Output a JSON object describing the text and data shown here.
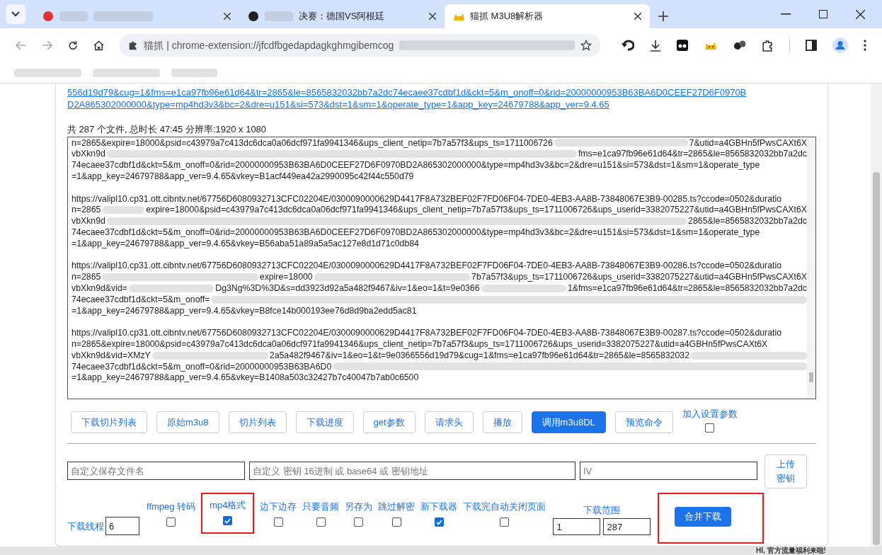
{
  "browser": {
    "tabs": [
      {
        "selected": false
      },
      {
        "title": "决赛：德国VS阿根廷",
        "selected": false
      },
      {
        "title": "猫抓 M3U8解析器",
        "selected": true
      }
    ],
    "address": "猫抓 | chrome-extension://jfcdfbgedapdagkghmgibemcog"
  },
  "link_lines": [
    "556d19d79&cug=1&fms=e1ca97fb96e61d64&tr=2865&le=8565832032bb7a2dc74ecaee37cdbf1d&ckt=5&m_onoff=0&rid=20000000953B63BA6D0CEEF27D6F0970B",
    "D2A865302000000&type=mp4hd3v3&bc=2&dre=u151&si=573&dst=1&sm=1&operate_type=1&app_key=24679788&app_ver=9.4.65"
  ],
  "summary": "共 287 个文件, 总时长 47:45 分辨率:1920 x 1080",
  "playlist_entries": [
    {
      "lines": [
        {
          "parts": [
            "n=2865&expire=18000&psid=c43979a7c413dc6dca0a06dcf971fa9941346&ups_client_netip=7b7a57f3&ups_ts=1711006726",
            "7&utid=a4GBHn5fPwsCAXt6X"
          ]
        },
        {
          "parts": [
            "vbXkn9d",
            "fms=e1ca97fb96e61d64&tr=2865&le=8565832032bb7a2dc"
          ]
        },
        {
          "parts": [
            "74ecaee37cdbf1d&ckt=5&m_onoff=0&rid=20000000953B63BA6D0CEEF27D6F0970BD2A865302000000&type=mp4hd3v3&bc=2&dre=u151&si=573&dst=1&sm=1&operate_type"
          ]
        },
        {
          "parts": [
            "=1&app_key=24679788&app_ver=9.4.65&vkey=B1acf449ea42a2990095c42f44c550d79"
          ]
        }
      ]
    },
    {
      "lines": [
        {
          "parts": [
            "https://valipl10.cp31.ott.cibntv.net/67756D6080932713CFC02204E/0300090000629D4417F8A732BEF02F7FD06F04-7DE0-4EB3-AA8B-73848067E3B9-00285.ts?ccode=0502&duratio"
          ]
        },
        {
          "parts": [
            "n=2865",
            "expire=18000&psid=c43979a7c413dc6dca0a06dcf971fa9941346&ups_client_netip=7b7a57f3&ups_ts=1711006726&ups_userid=3382075227&utid=a4GBHn5fPwsCAXt6X"
          ]
        },
        {
          "parts": [
            "vbXkn9d",
            "2865&le=8565832032bb7a2dc"
          ]
        },
        {
          "parts": [
            "74ecaee37cdbf1d&ckt=5&m_onoff=0&rid=20000000953B63BA6D0CEEF27D6F0970BD2A865302000000&type=mp4hd3v3&bc=2&dre=u151&si=573&dst=1&sm=1&operate_type"
          ]
        },
        {
          "parts": [
            "=1&app_key=24679788&app_ver=9.4.65&vkey=B56aba51a89a5a5ac127e8d1d71c0db84"
          ]
        }
      ]
    },
    {
      "lines": [
        {
          "parts": [
            "https://valipl10.cp31.ott.cibntv.net/67756D6080932713CFC02204E/0300090000629D4417F8A732BEF02F7FD06F04-7DE0-4EB3-AA8B-73848067E3B9-00286.ts?ccode=0502&duratio"
          ]
        },
        {
          "parts": [
            "n=2865",
            "expire=18000",
            "7b7a57f3&ups_ts=1711006726&ups_userid=3382075227&utid=a4GBHn5fPwsCAXt6X"
          ]
        },
        {
          "parts": [
            "vbXkn9d&vid=",
            "Dg3Ng%3D%3D&s=dd3923d92a5a482f9467&iv=1&eo=1&t=9e0366",
            "1&fms=e1ca97fb96e61d64&tr=2865&le=8565832032bb7a2dc"
          ]
        },
        {
          "parts": [
            "74ecaee37cdbf1d&ckt=5&m_onoff="
          ],
          "hidden_end": true
        },
        {
          "parts": [
            "=1&app_key=24679788&app_ver=9.4.65&vkey=B8fce14b000193ee76d8d9ba2edd5ac81"
          ]
        }
      ]
    },
    {
      "lines": [
        {
          "parts": [
            "https://valipl10.cp31.ott.cibntv.net/67756D6080932713CFC02204E/0300090000629D4417F8A732BEF02F7FD06F04-7DE0-4EB3-AA8B-73848067E3B9-00287.ts?ccode=0502&duratio"
          ]
        },
        {
          "parts": [
            "n=2865&expire=18000&psid=c43979a7c413dc6dca0a06dcf971fa9941346&ups_client_netip=7b7a57f3&ups_ts=1711006726&ups_userid=3382075227&utid=a4GBHn5fPwsCAXt6X"
          ]
        },
        {
          "parts": [
            "vbXkn9d&vid=XMzY",
            "2a5a482f9467&iv=1&eo=1&t=9e0366556d19d79&cug=1&fms=e1ca97fb96e61d64&tr=2865&le=8565832032"
          ],
          "hidden_end": true
        },
        {
          "parts": [
            "74ecaee37cdbf1d&ckt=5&m_onoff=0&rid=20000000953B63BA6D0"
          ],
          "hidden_end": true
        },
        {
          "parts": [
            "=1&app_key=24679788&app_ver=9.4.65&vkey=B1408a503c32427b7c40047b7ab0c6500"
          ]
        }
      ]
    }
  ],
  "action_buttons": [
    {
      "label": "下载切片列表",
      "primary": false
    },
    {
      "label": "原始m3u8",
      "primary": false
    },
    {
      "label": "切片列表",
      "primary": false
    },
    {
      "label": "下载进度",
      "primary": false
    },
    {
      "label": "get参数",
      "primary": false
    },
    {
      "label": "请求头",
      "primary": false
    },
    {
      "label": "播放",
      "primary": false
    },
    {
      "label": "调用m3u8DL",
      "primary": true
    },
    {
      "label": "预览命令",
      "primary": false
    }
  ],
  "add_settings": {
    "label": "加入设置参数",
    "checked": false
  },
  "fields": [
    {
      "placeholder": "自定义保存文件名"
    },
    {
      "placeholder": "自定义 密钥 16进制 或 base64 或 密钥地址"
    },
    {
      "placeholder": "IV"
    }
  ],
  "upload_key_button": "上传密钥",
  "threads": {
    "label": "下载线程",
    "value": "6"
  },
  "options": [
    {
      "label": "ffmpeg 转码",
      "checked": false,
      "highlighted": false
    },
    {
      "label": "mp4格式",
      "checked": true,
      "highlighted": true
    },
    {
      "label": "边下边存",
      "checked": false,
      "highlighted": false
    },
    {
      "label": "只要音频",
      "checked": false,
      "highlighted": false
    },
    {
      "label": "另存为",
      "checked": false,
      "highlighted": false
    },
    {
      "label": "跳过解密",
      "checked": false,
      "highlighted": false
    },
    {
      "label": "新下载器",
      "checked": true,
      "highlighted": false
    },
    {
      "label": "下载完自动关闭页面",
      "checked": false,
      "highlighted": false
    }
  ],
  "range": {
    "label": "下载范围",
    "from": "1",
    "to": "287"
  },
  "merge_button": {
    "label": "合并下载",
    "highlighted": true
  },
  "background_text": "HI, 官方流量福利来啦!"
}
